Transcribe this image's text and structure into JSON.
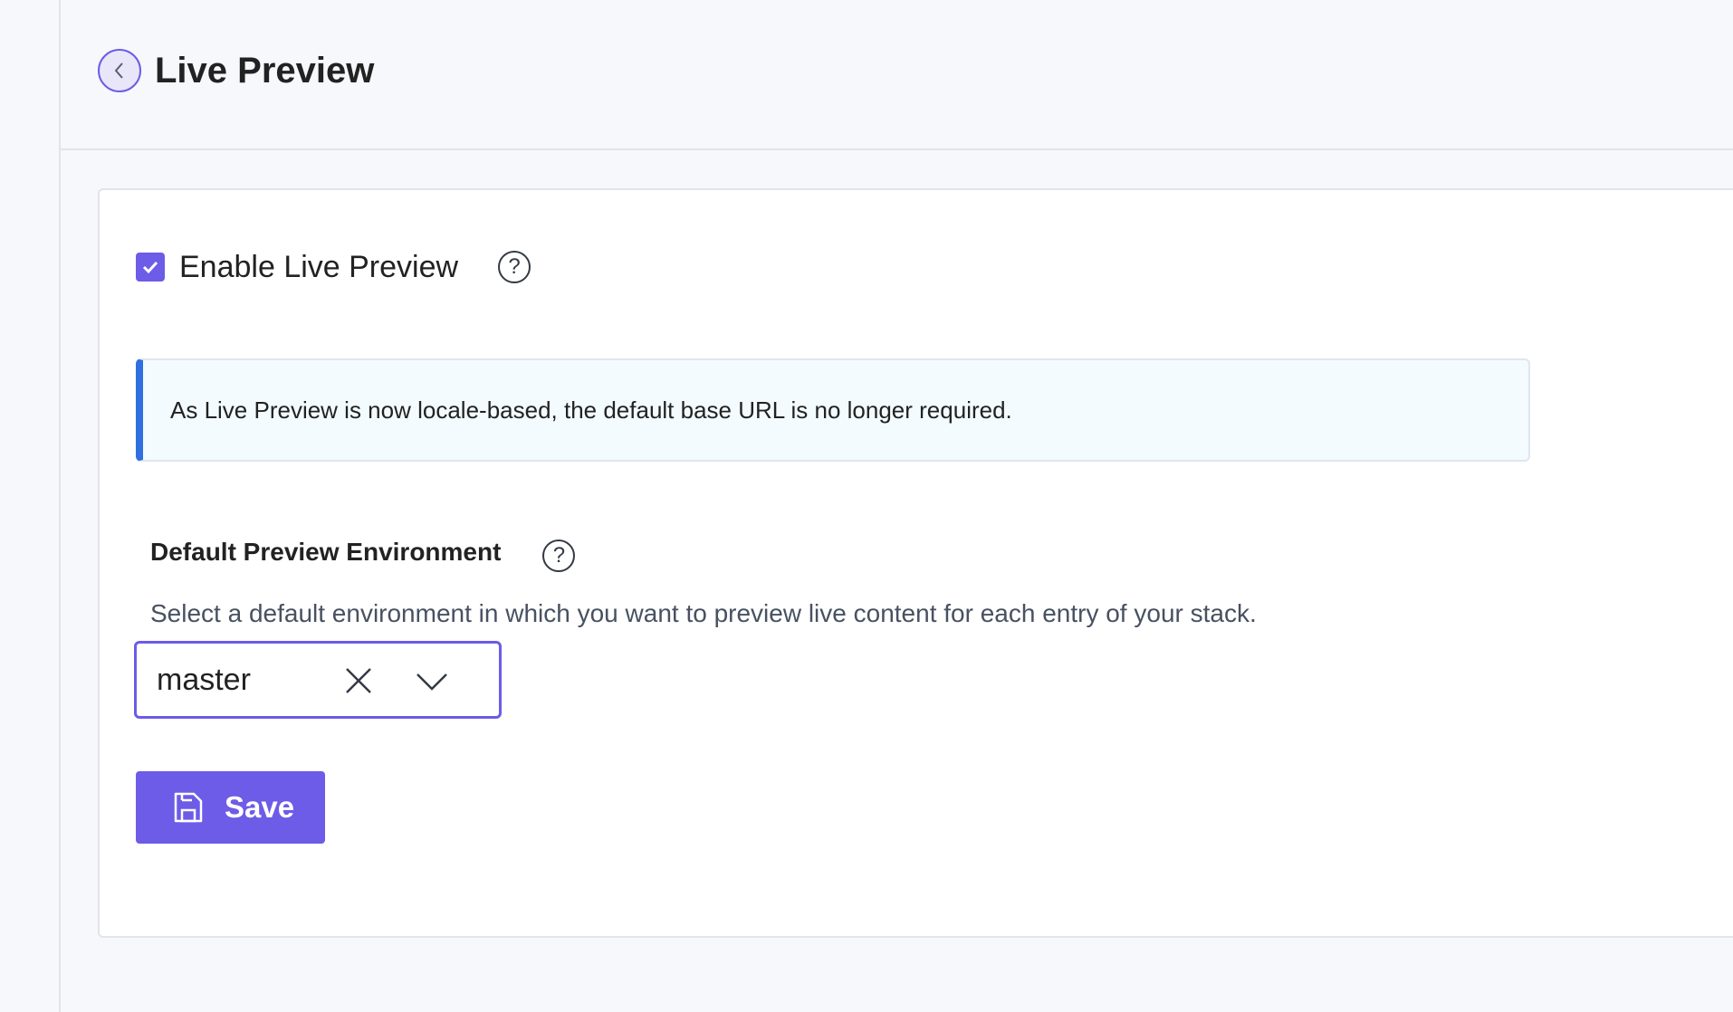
{
  "header": {
    "title": "Live Preview",
    "back_icon": "chevron-left-icon"
  },
  "settings": {
    "enable_label": "Enable Live Preview",
    "enable_checked": true,
    "info_message": "As Live Preview is now locale-based, the default base URL is no longer required.",
    "environment": {
      "title": "Default Preview Environment",
      "description": "Select a default environment in which you want to preview live content for each entry of your stack.",
      "selected_value": "master"
    },
    "save_label": "Save"
  },
  "colors": {
    "accent": "#6c5ce7",
    "info_border": "#2f6fe0",
    "info_background": "#f3fbff",
    "page_background": "#f7f8fc"
  }
}
